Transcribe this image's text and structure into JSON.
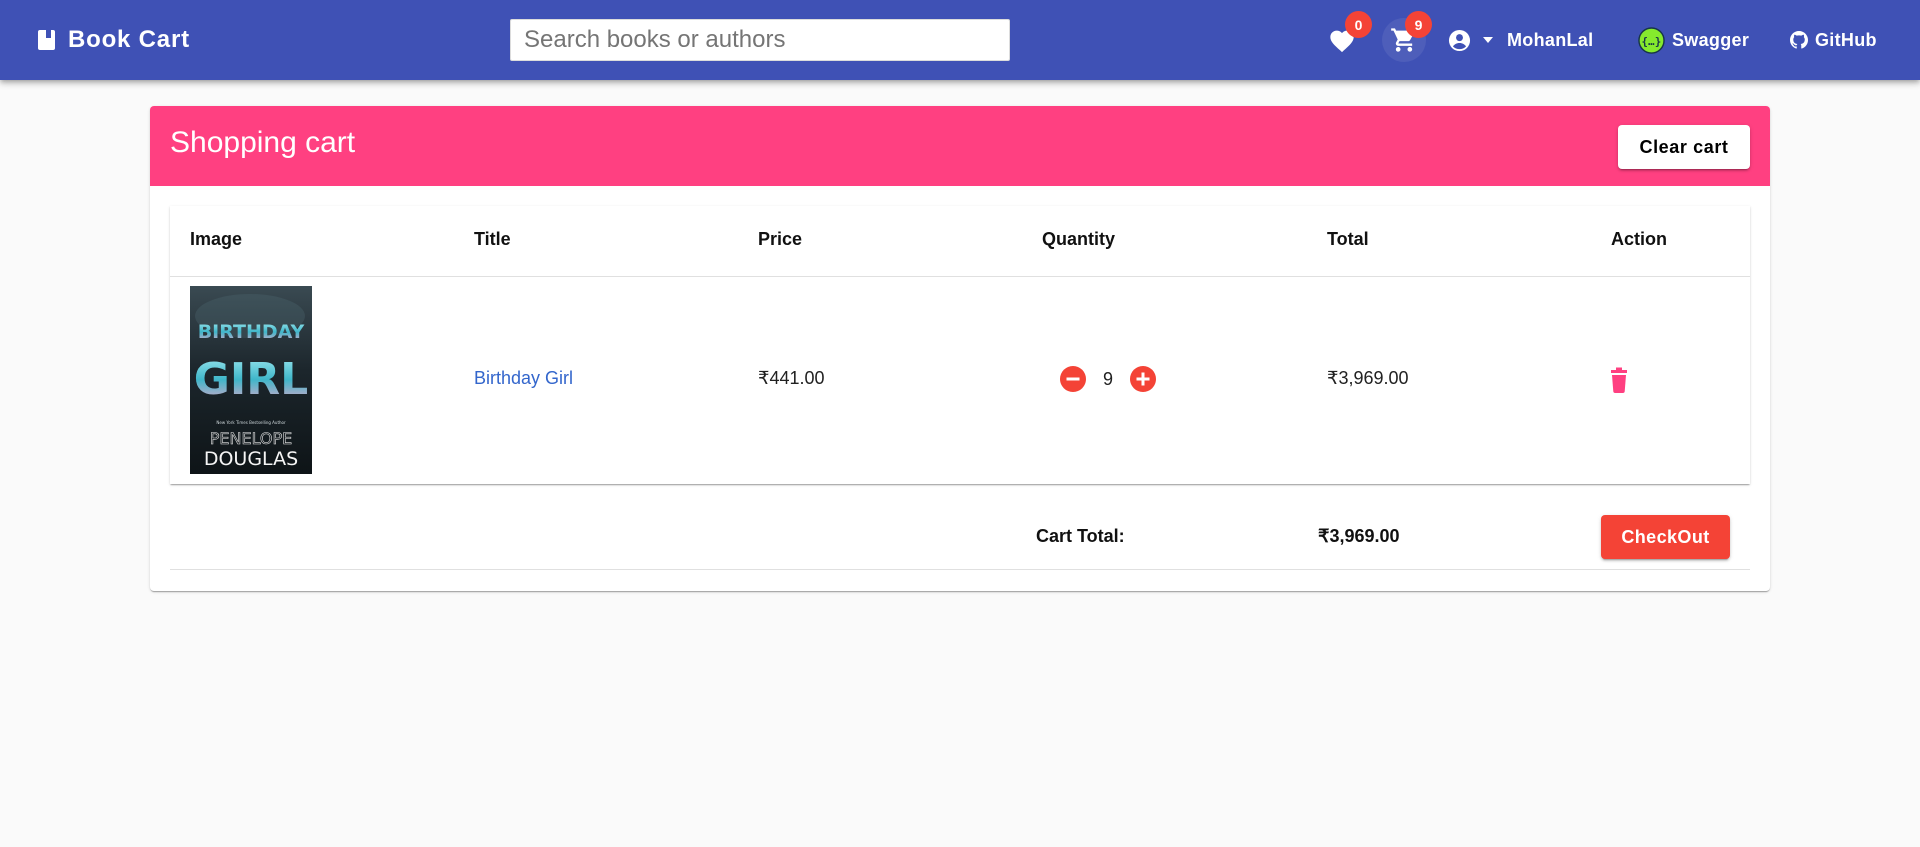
{
  "header": {
    "brand": "Book Cart",
    "search_placeholder": "Search books or authors",
    "wishlist_count": "0",
    "cart_count": "9",
    "user_name": "MohanLal",
    "swagger_label": "Swagger",
    "github_label": "GitHub"
  },
  "cart": {
    "title": "Shopping cart",
    "clear_label": "Clear cart",
    "columns": [
      "Image",
      "Title",
      "Price",
      "Quantity",
      "Total",
      "Action"
    ],
    "items": [
      {
        "cover_title_line1": "BIRTHDAY",
        "cover_title_line2": "GIRL",
        "cover_tagline": "New York Times Bestselling Author",
        "cover_author_first": "PENELOPE",
        "cover_author_last": "DOUGLAS",
        "title": "Birthday Girl",
        "price": "₹441.00",
        "quantity": "9",
        "total": "₹3,969.00"
      }
    ],
    "total_label": "Cart Total:",
    "total_value": "₹3,969.00",
    "checkout_label": "CheckOut"
  },
  "colors": {
    "toolbar": "#3f51b5",
    "cart_header": "#ff4081",
    "warn": "#f44336",
    "link": "#3366cc"
  },
  "icons": {
    "brand": "book-icon",
    "wishlist": "heart-icon",
    "cart": "shopping-cart-icon",
    "user": "account-circle-icon",
    "dropdown": "caret-down-icon",
    "swagger": "swagger-icon",
    "github": "github-icon",
    "decrease": "remove-circle-icon",
    "increase": "add-circle-icon",
    "delete": "trash-icon"
  }
}
